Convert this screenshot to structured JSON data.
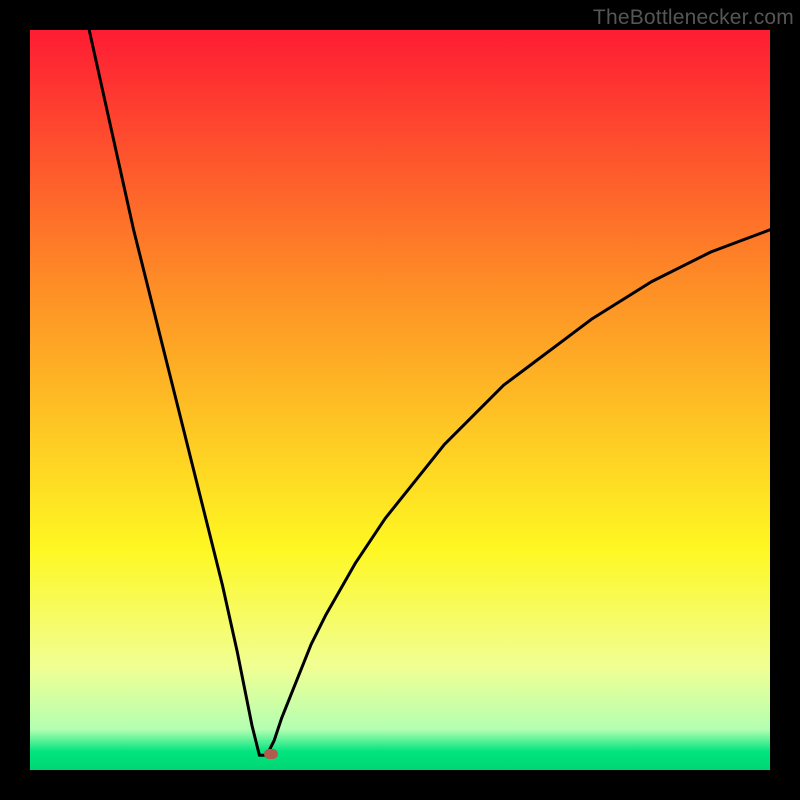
{
  "watermark": "TheBottlenecker.com",
  "colors": {
    "top": "#fe1c33",
    "mid_upper": "#fe8f26",
    "mid": "#fef722",
    "mid_lower": "#f1ff93",
    "green1": "#b4ffb2",
    "green2": "#00e47e",
    "green3": "#00d674",
    "curve": "#000000",
    "marker": "#b15b4c",
    "frame": "#000000"
  },
  "chart_data": {
    "type": "line",
    "title": "",
    "xlabel": "",
    "ylabel": "",
    "xlim": [
      0,
      100
    ],
    "ylim": [
      0,
      100
    ],
    "optimum_x": 31,
    "marker": {
      "x": 32.5,
      "y": 2.2
    },
    "series": [
      {
        "name": "bottleneck-curve",
        "x": [
          8,
          10,
          12,
          14,
          16,
          18,
          20,
          22,
          24,
          26,
          28,
          29,
          30,
          31,
          32,
          33,
          34,
          36,
          38,
          40,
          44,
          48,
          52,
          56,
          60,
          64,
          68,
          72,
          76,
          80,
          84,
          88,
          92,
          96,
          100
        ],
        "y": [
          100,
          91,
          82,
          73,
          65,
          57,
          49,
          41,
          33,
          25,
          16,
          11,
          6,
          2,
          2,
          4,
          7,
          12,
          17,
          21,
          28,
          34,
          39,
          44,
          48,
          52,
          55,
          58,
          61,
          63.5,
          66,
          68,
          70,
          71.5,
          73
        ]
      }
    ]
  }
}
